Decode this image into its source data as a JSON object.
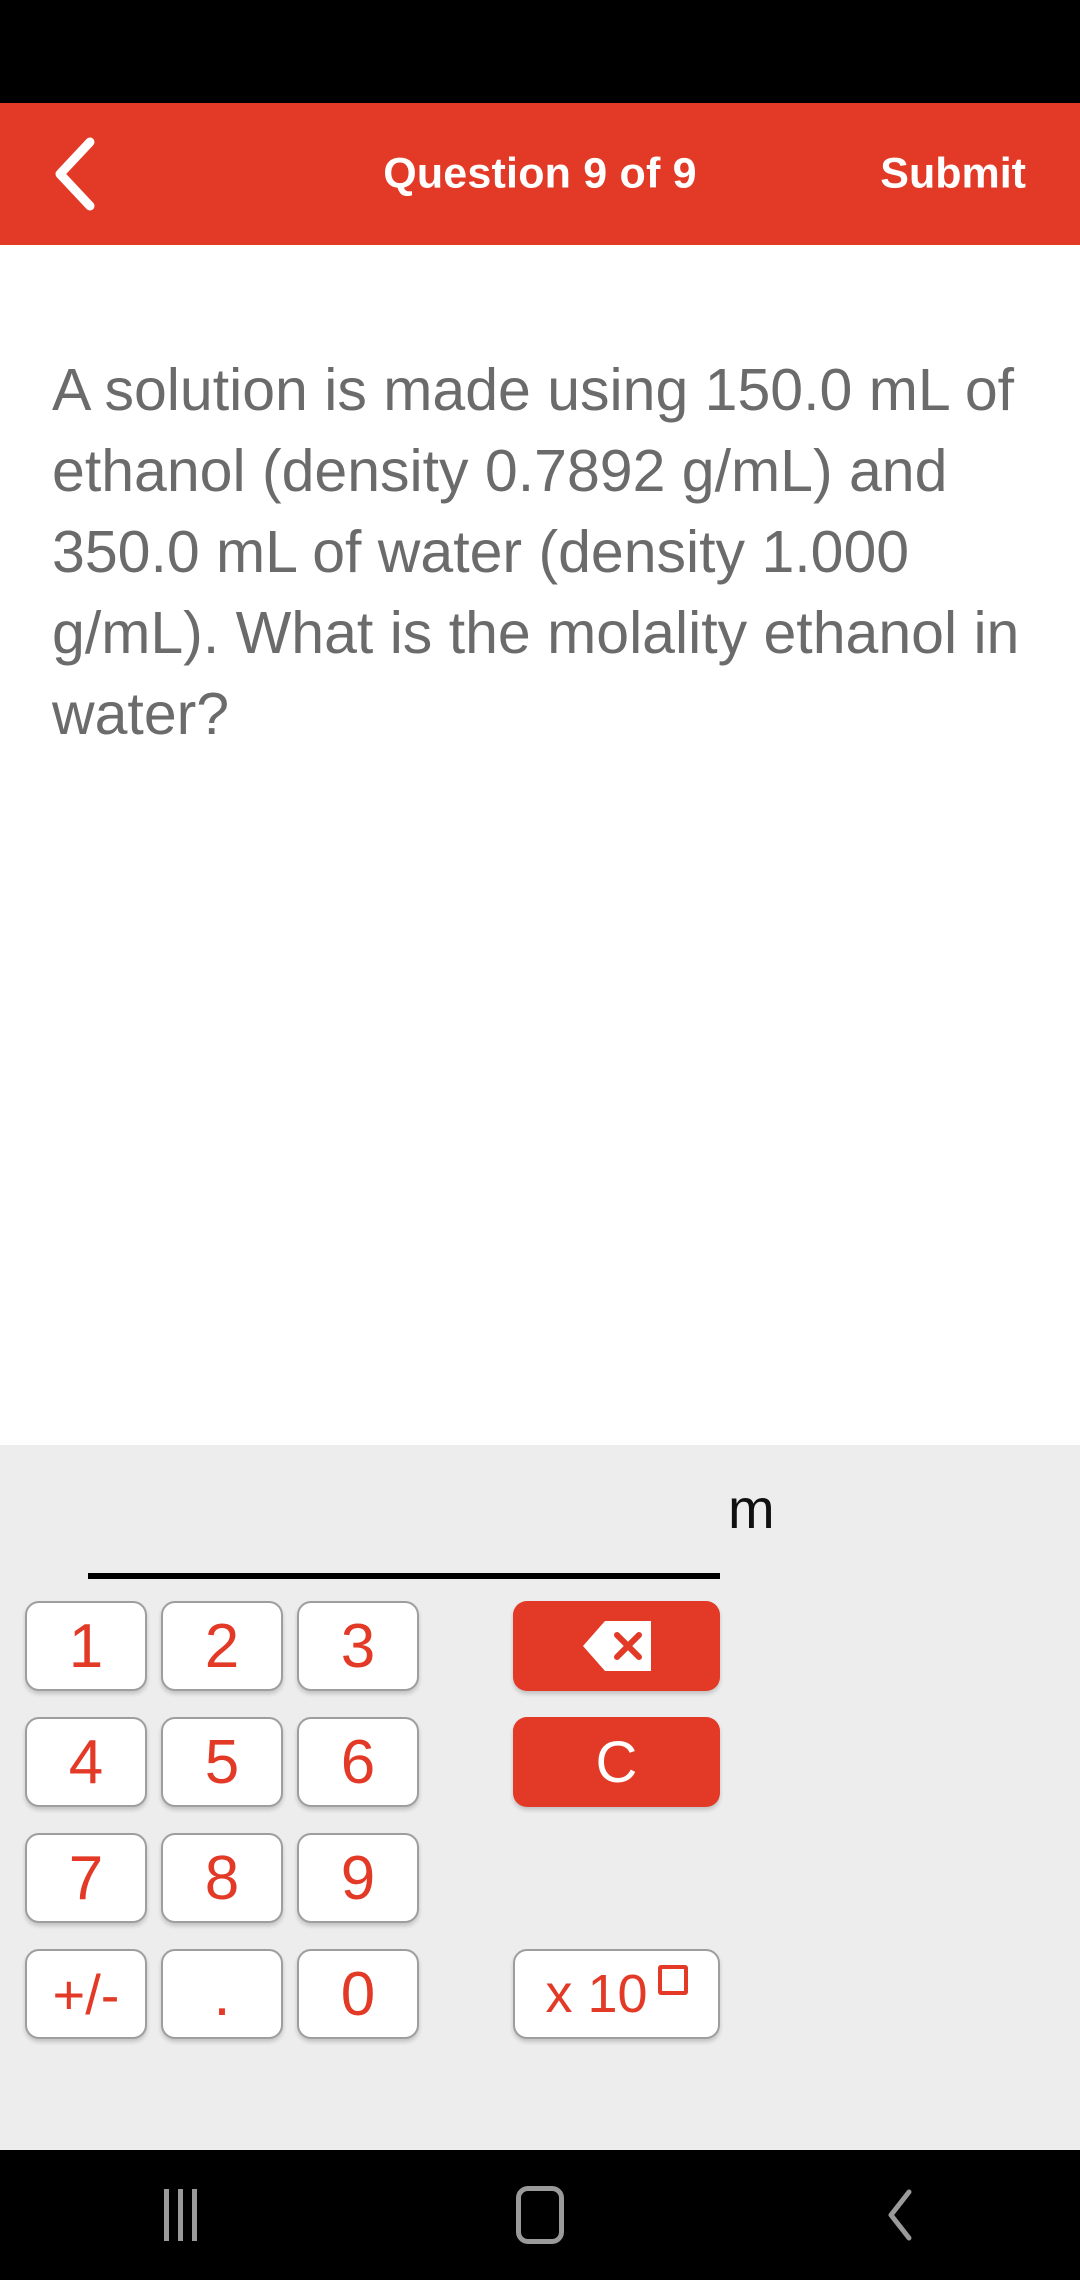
{
  "header": {
    "back_icon": "chevron-left-icon",
    "title": "Question 9 of 9",
    "submit_label": "Submit",
    "background_color": "#E23A26",
    "text_color": "#FFFFFF"
  },
  "question": {
    "text": "A solution is made using 150.0 mL of ethanol (density 0.7892 g/mL) and 350.0 mL of water (density 1.000 g/mL). What is the molality ethanol in water?",
    "text_color": "#6B6B6B"
  },
  "answer": {
    "value": "",
    "placeholder": "",
    "unit": "m",
    "underline_color": "#000000"
  },
  "keypad": {
    "background_color": "#EDEDED",
    "key_text_color": "#E23A26",
    "action_key_color": "#E23A26",
    "rows": [
      [
        {
          "name": "key-1",
          "label": "1",
          "type": "num"
        },
        {
          "name": "key-2",
          "label": "2",
          "type": "num"
        },
        {
          "name": "key-3",
          "label": "3",
          "type": "num"
        },
        {
          "name": "key-backspace",
          "label": "",
          "type": "action",
          "icon": "backspace-icon"
        }
      ],
      [
        {
          "name": "key-4",
          "label": "4",
          "type": "num"
        },
        {
          "name": "key-5",
          "label": "5",
          "type": "num"
        },
        {
          "name": "key-6",
          "label": "6",
          "type": "num"
        },
        {
          "name": "key-clear",
          "label": "C",
          "type": "action"
        }
      ],
      [
        {
          "name": "key-7",
          "label": "7",
          "type": "num"
        },
        {
          "name": "key-8",
          "label": "8",
          "type": "num"
        },
        {
          "name": "key-9",
          "label": "9",
          "type": "num"
        }
      ],
      [
        {
          "name": "key-plus-minus",
          "label": "+/-",
          "type": "num"
        },
        {
          "name": "key-decimal",
          "label": ".",
          "type": "num"
        },
        {
          "name": "key-0",
          "label": "0",
          "type": "num"
        },
        {
          "name": "key-exponent",
          "label": "x 10",
          "type": "exp"
        }
      ]
    ]
  },
  "nav_bar": {
    "recents_icon": "recents-icon",
    "home_icon": "home-icon",
    "back_icon": "back-icon",
    "icon_color": "#9A9A9A",
    "background_color": "#000000"
  }
}
